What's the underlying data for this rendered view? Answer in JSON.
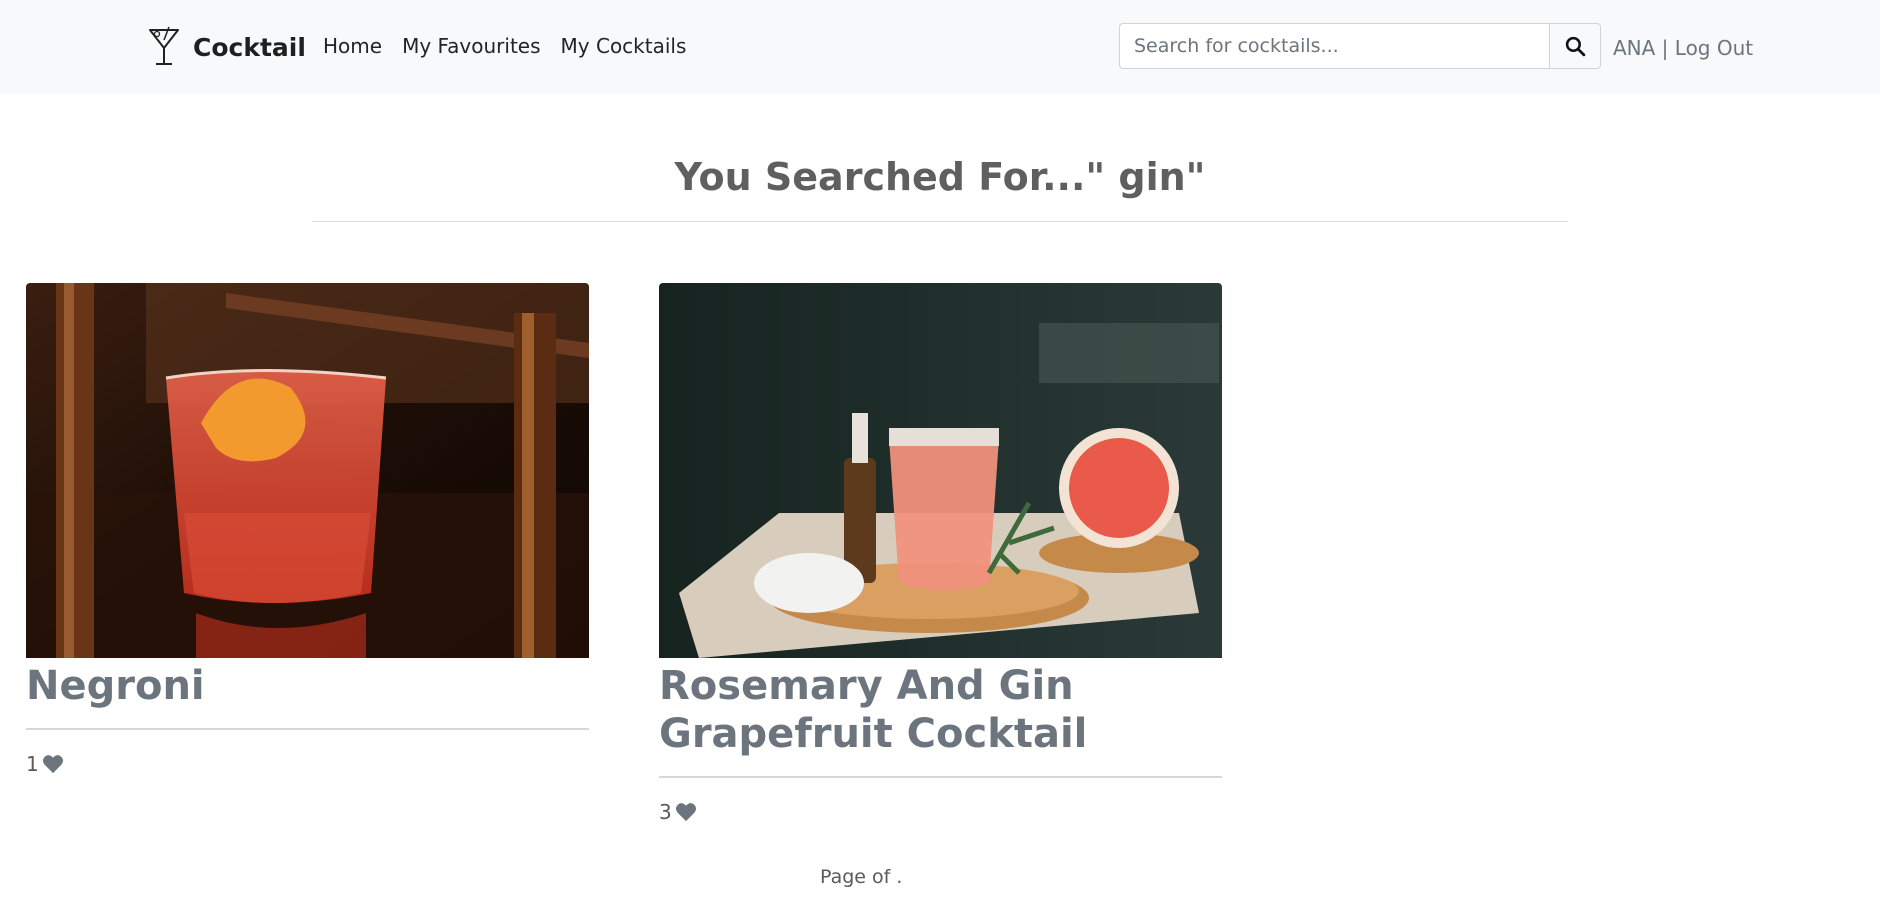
{
  "brand": {
    "name": "Cocktail",
    "icon": "martini-glass-icon"
  },
  "nav": {
    "links": [
      "Home",
      "My Favourites",
      "My Cocktails"
    ]
  },
  "search": {
    "placeholder": "Search for cocktails...",
    "value": "",
    "icon": "search-icon"
  },
  "user": {
    "text": "ANA | Log Out"
  },
  "page": {
    "title": "You Searched For...\" gin\""
  },
  "results": [
    {
      "name": "Negroni",
      "likes": "1",
      "image": "negroni-photo"
    },
    {
      "name": "Rosemary And Gin Grapefruit Cocktail",
      "likes": "3",
      "image": "grapefruit-cocktail-photo"
    }
  ],
  "pagination": {
    "text": "Page of ."
  },
  "colors": {
    "navbar_bg": "#f8f9fa",
    "text_muted": "#6c757d",
    "heart": "#6c757d"
  }
}
